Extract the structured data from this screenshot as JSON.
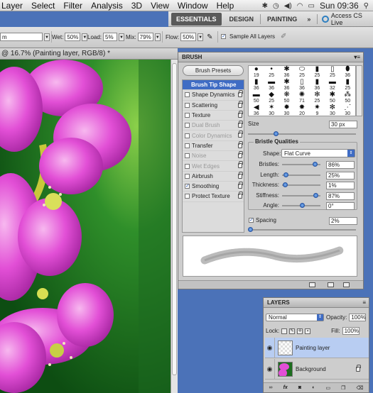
{
  "menubar": {
    "items": [
      "Layer",
      "Select",
      "Filter",
      "Analysis",
      "3D",
      "View",
      "Window",
      "Help"
    ],
    "clock": "Sun 09:36"
  },
  "workspace": {
    "essentials": "ESSENTIALS",
    "design": "DESIGN",
    "painting": "PAINTING",
    "more": "»",
    "cs_live": "Access CS Live"
  },
  "options": {
    "mode_value": "m",
    "wet_label": "Wet:",
    "wet_value": "50%",
    "load_label": "Load:",
    "load_value": "5%",
    "mix_label": "Mix:",
    "mix_value": "79%",
    "flow_label": "Flow:",
    "flow_value": "50%",
    "sample_all_layers": "Sample All Layers"
  },
  "document": {
    "tab_title": "@ 16.7% (Painting layer, RGB/8) *"
  },
  "brush_panel": {
    "title": "BRUSH",
    "presets_button": "Brush Presets",
    "settings": [
      {
        "label": "Brush Tip Shape",
        "selected": true,
        "checked": false,
        "enabled": true,
        "lock": false
      },
      {
        "label": "Shape Dynamics",
        "selected": false,
        "checked": false,
        "enabled": true,
        "lock": true
      },
      {
        "label": "Scattering",
        "selected": false,
        "checked": false,
        "enabled": true,
        "lock": true
      },
      {
        "label": "Texture",
        "selected": false,
        "checked": false,
        "enabled": true,
        "lock": true
      },
      {
        "label": "Dual Brush",
        "selected": false,
        "checked": false,
        "enabled": false,
        "lock": true
      },
      {
        "label": "Color Dynamics",
        "selected": false,
        "checked": false,
        "enabled": false,
        "lock": true
      },
      {
        "label": "Transfer",
        "selected": false,
        "checked": false,
        "enabled": true,
        "lock": true
      },
      {
        "label": "Noise",
        "selected": false,
        "checked": false,
        "enabled": false,
        "lock": true
      },
      {
        "label": "Wet Edges",
        "selected": false,
        "checked": false,
        "enabled": false,
        "lock": true
      },
      {
        "label": "Airbrush",
        "selected": false,
        "checked": false,
        "enabled": true,
        "lock": true
      },
      {
        "label": "Smoothing",
        "selected": false,
        "checked": true,
        "enabled": true,
        "lock": true
      },
      {
        "label": "Protect Texture",
        "selected": false,
        "checked": false,
        "enabled": true,
        "lock": true
      }
    ],
    "tips": [
      {
        "glyph": "●",
        "size": "19"
      },
      {
        "glyph": "•",
        "size": "25"
      },
      {
        "glyph": "✱",
        "size": "36"
      },
      {
        "glyph": "⬭",
        "size": "25"
      },
      {
        "glyph": "▮",
        "size": "25"
      },
      {
        "glyph": "▯",
        "size": "25"
      },
      {
        "glyph": "⬮",
        "size": "36"
      },
      {
        "glyph": "▮",
        "size": "36"
      },
      {
        "glyph": "▬",
        "size": "36"
      },
      {
        "glyph": "✱",
        "size": "36"
      },
      {
        "glyph": "▯",
        "size": "36"
      },
      {
        "glyph": "▮",
        "size": "36"
      },
      {
        "glyph": "▬",
        "size": "32"
      },
      {
        "glyph": "▮",
        "size": "25"
      },
      {
        "glyph": "▬",
        "size": "50"
      },
      {
        "glyph": "◆",
        "size": "25"
      },
      {
        "glyph": "❋",
        "size": "50"
      },
      {
        "glyph": "✺",
        "size": "71"
      },
      {
        "glyph": "✻",
        "size": "25"
      },
      {
        "glyph": "✱",
        "size": "50"
      },
      {
        "glyph": "⁂",
        "size": "50"
      },
      {
        "glyph": "◀",
        "size": "36"
      },
      {
        "glyph": "✶",
        "size": "30"
      },
      {
        "glyph": "✹",
        "size": "30"
      },
      {
        "glyph": "✸",
        "size": "20"
      },
      {
        "glyph": "✷",
        "size": "9"
      },
      {
        "glyph": "✻",
        "size": "30"
      },
      {
        "glyph": "⋰",
        "size": "30"
      }
    ],
    "size_label": "Size",
    "size_value": "30 px",
    "qualities_label": "Bristle Qualities",
    "shape_label": "Shape:",
    "shape_value": "Flat Curve",
    "sliders": [
      {
        "label": "Bristles:",
        "value": "86%",
        "level": 0.86
      },
      {
        "label": "Length:",
        "value": "25%",
        "level": 0.03
      },
      {
        "label": "Thickness:",
        "value": "1%",
        "level": 0.01
      },
      {
        "label": "Stiffness:",
        "value": "87%",
        "level": 0.87
      },
      {
        "label": "Angle:",
        "value": "0°",
        "level": 0.5
      }
    ],
    "spacing_label": "Spacing",
    "spacing_value": "2%"
  },
  "layers_panel": {
    "title": "LAYERS",
    "blend_mode": "Normal",
    "opacity_label": "Opacity:",
    "opacity_value": "100%",
    "lock_label": "Lock:",
    "fill_label": "Fill:",
    "fill_value": "100%",
    "layers": [
      {
        "name": "Painting layer",
        "selected": true
      },
      {
        "name": "Background",
        "selected": false
      }
    ],
    "footer_icons": [
      "link-icon",
      "fx-icon",
      "mask-icon",
      "adjustment-icon",
      "folder-icon",
      "new-layer-icon",
      "trash-icon"
    ]
  },
  "colors": {
    "accent": "#3f6cc4",
    "desktop": "#4b72b8",
    "flower": "#d93fd0"
  }
}
